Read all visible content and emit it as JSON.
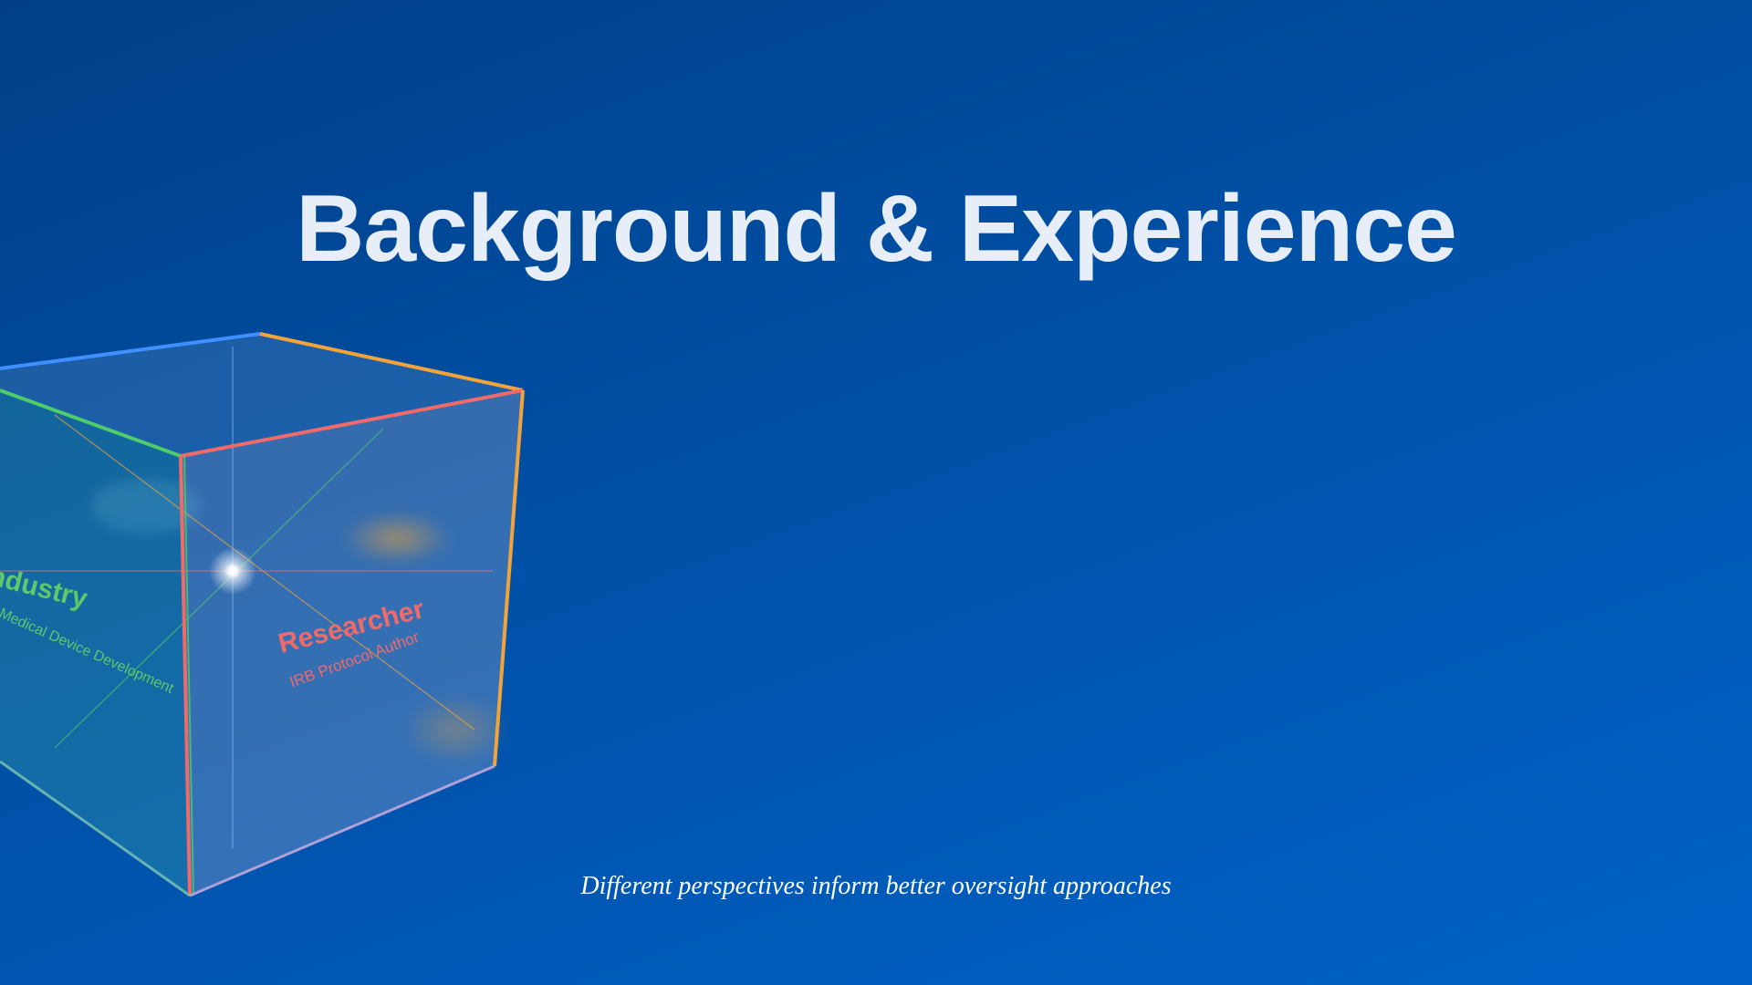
{
  "slide": {
    "title": "Background & Experience",
    "caption": "Different perspectives inform better oversight approaches"
  },
  "cube": {
    "faces": [
      {
        "title": "Industry",
        "subtitle": "Medical Device Development",
        "color": "#5ec86a"
      },
      {
        "title": "Researcher",
        "subtitle": "IRB Protocol Author",
        "color": "#f06a6a"
      }
    ],
    "edge_colors": {
      "top_back": "#3f8fff",
      "top_right": "#f2a43a",
      "top_left": "#4ecb6a",
      "top_front": "#f06a6a",
      "front_left": "#f06a6a",
      "front_right": "#f2a43a",
      "bottom": "#b0a0d8"
    }
  }
}
